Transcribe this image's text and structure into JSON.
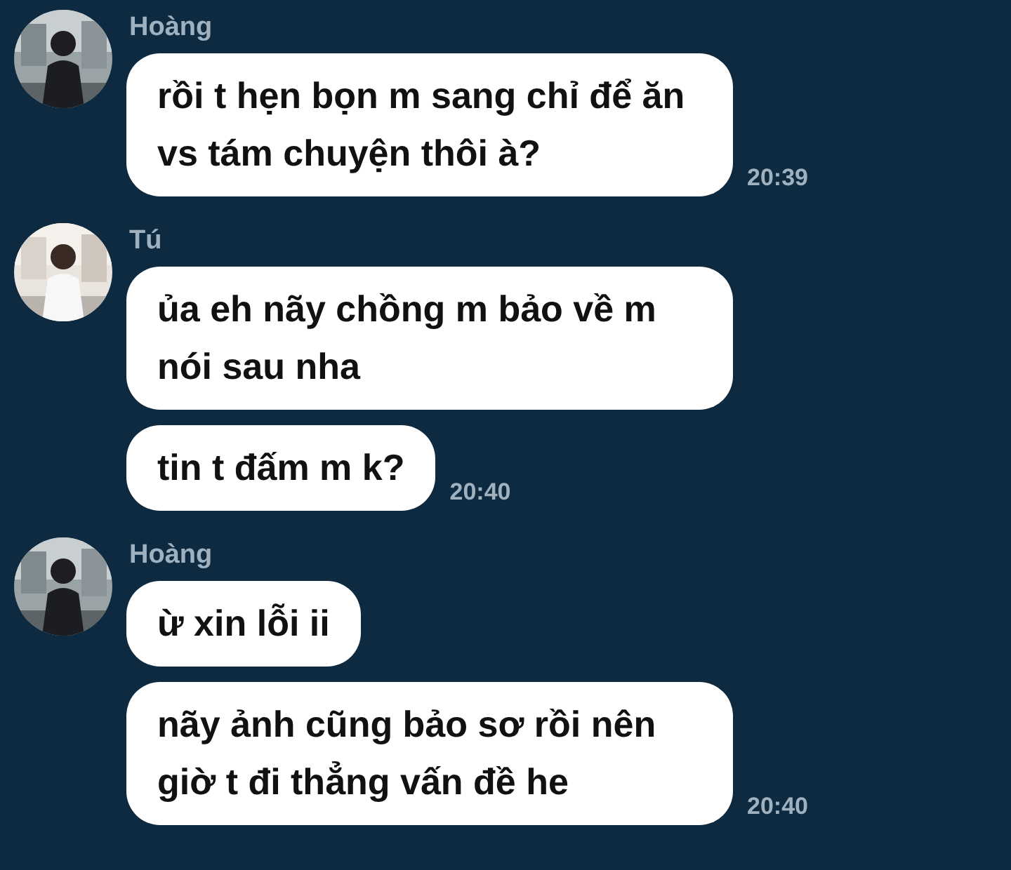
{
  "groups": [
    {
      "sender": "Hoàng",
      "avatar": {
        "kind": "picture"
      },
      "messages": [
        {
          "text": "rồi t hẹn bọn m sang chỉ để ăn vs tám chuyện thôi à?",
          "time": "20:39"
        }
      ]
    },
    {
      "sender": "Tú",
      "avatar": {
        "kind": "picture"
      },
      "messages": [
        {
          "text": "ủa eh nãy chồng m bảo về m nói sau nha"
        },
        {
          "text": "tin t đấm m k?",
          "time": "20:40"
        }
      ]
    },
    {
      "sender": "Hoàng",
      "avatar": {
        "kind": "picture"
      },
      "messages": [
        {
          "text": "ừ xin lỗi ii"
        },
        {
          "text": "nãy ảnh cũng bảo sơ rồi nên giờ t đi thẳng vấn đề he",
          "time": "20:40"
        }
      ]
    }
  ]
}
